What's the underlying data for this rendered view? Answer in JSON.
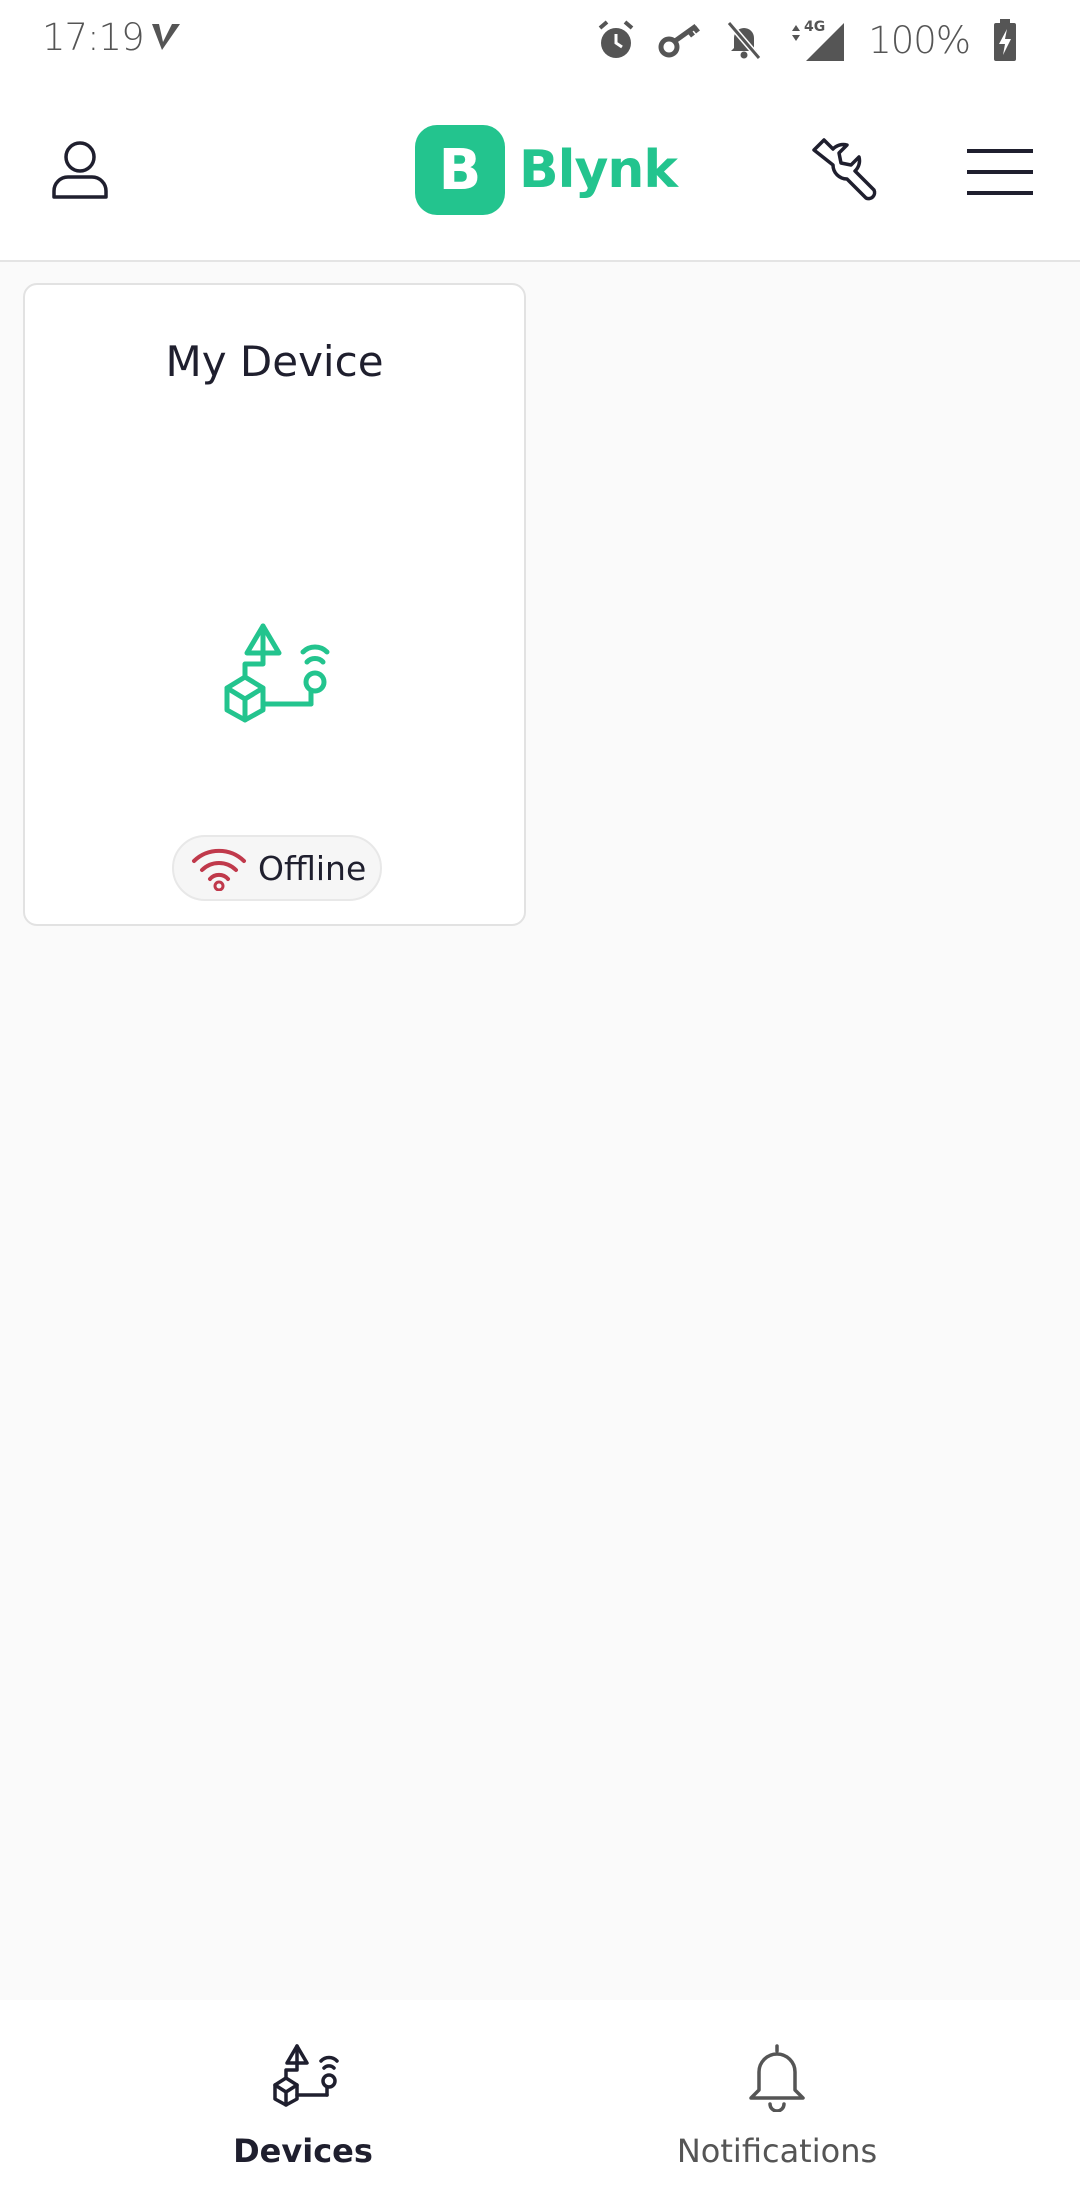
{
  "status_bar": {
    "time": "17:19",
    "network": "4G",
    "battery_percent": "100%",
    "icons": [
      "vpn-v-icon",
      "alarm-icon",
      "key-icon",
      "bell-muted-icon",
      "signal-icon",
      "battery-charging-icon"
    ]
  },
  "header": {
    "logo_letter": "B",
    "logo_text": "Blynk",
    "icons": [
      "profile-icon",
      "wrench-icon",
      "menu-icon"
    ],
    "brand_color": "#23c48e"
  },
  "devices": [
    {
      "name": "My Device",
      "icon": "device-template-icon",
      "status": "Offline",
      "status_icon": "wifi-offline-icon",
      "status_color": "#c0394b"
    }
  ],
  "bottom_nav": {
    "items": [
      {
        "label": "Devices",
        "icon": "devices-icon",
        "active": true
      },
      {
        "label": "Notifications",
        "icon": "bell-icon",
        "active": false
      }
    ]
  }
}
